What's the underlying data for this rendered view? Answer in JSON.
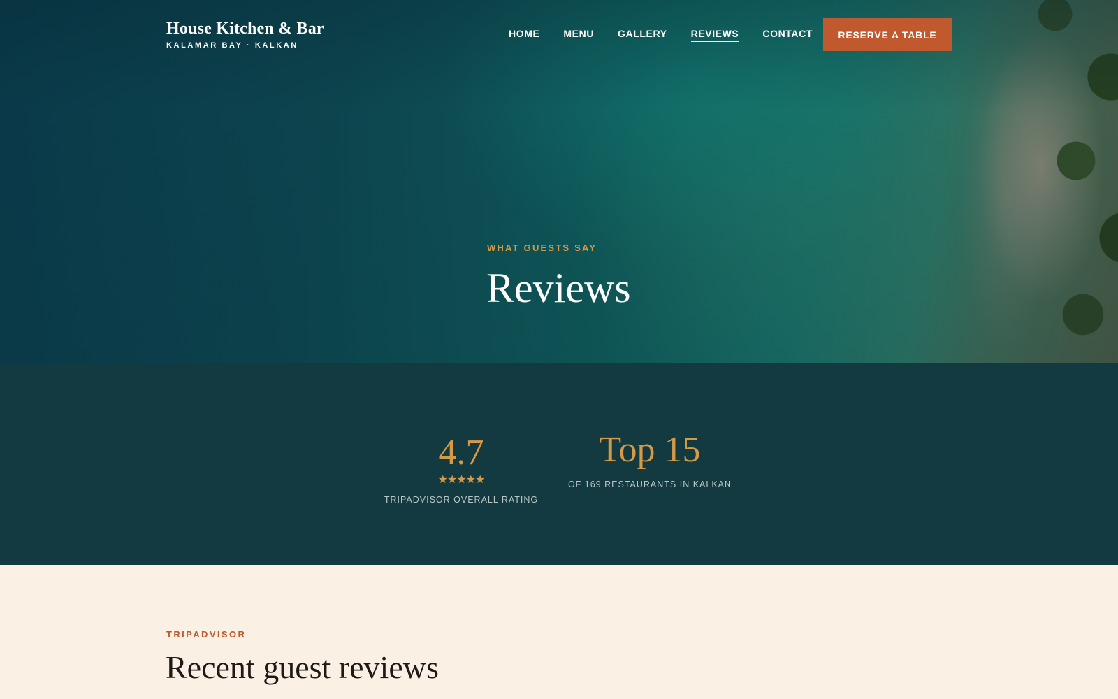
{
  "header": {
    "brand_name": "House Kitchen & Bar",
    "brand_sub": "KALAMAR BAY · KALKAN",
    "nav": [
      {
        "label": "HOME",
        "active": false
      },
      {
        "label": "MENU",
        "active": false
      },
      {
        "label": "GALLERY",
        "active": false
      },
      {
        "label": "REVIEWS",
        "active": true
      },
      {
        "label": "CONTACT",
        "active": false
      }
    ],
    "cta_label": "RESERVE A TABLE"
  },
  "hero": {
    "eyebrow": "WHAT GUESTS SAY",
    "title": "Reviews"
  },
  "stats": {
    "rating": {
      "value": "4.7",
      "stars": "★★★★★",
      "label": "TRIPADVISOR OVERALL RATING"
    },
    "rank": {
      "value": "Top 15",
      "label": "OF 169 RESTAURANTS IN KALKAN"
    }
  },
  "reviews": {
    "eyebrow": "TRIPADVISOR",
    "title": "Recent guest reviews"
  },
  "colors": {
    "accent": "#c05a2e",
    "gold": "#d49a45",
    "band": "#133a41",
    "cream": "#faf1e4"
  }
}
